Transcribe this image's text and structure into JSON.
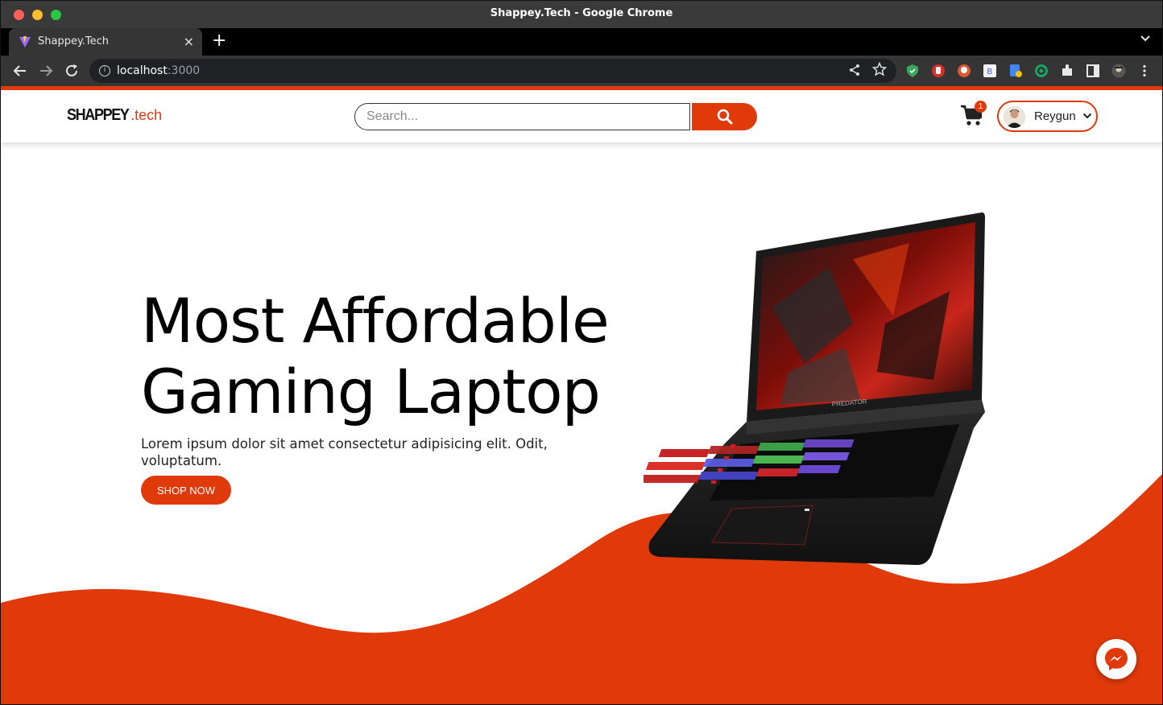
{
  "window": {
    "title": "Shappey.Tech - Google Chrome"
  },
  "tab": {
    "title": "Shappey.Tech",
    "close_label": "×"
  },
  "newtab": {
    "label": "+"
  },
  "address": {
    "host": "localhost",
    "port": ":3000"
  },
  "site": {
    "logo_main": "SHAPPEY",
    "logo_sub": ".tech",
    "search_placeholder": "Search...",
    "cart_count": "1",
    "user_name": "Reygun"
  },
  "hero": {
    "title": "Most Affordable Gaming Laptop",
    "description": "Lorem ipsum dolor sit amet consectetur adipisicing elit. Odit, voluptatum.",
    "cta_label": "SHOP NOW"
  },
  "icons": {
    "back": "arrow-left-icon",
    "forward": "arrow-right-icon",
    "reload": "reload-icon",
    "cart": "cart-icon",
    "search": "magnifier-icon",
    "messenger": "messenger-icon"
  },
  "colors": {
    "accent": "#e03a0b",
    "chrome_dark": "#353535"
  }
}
